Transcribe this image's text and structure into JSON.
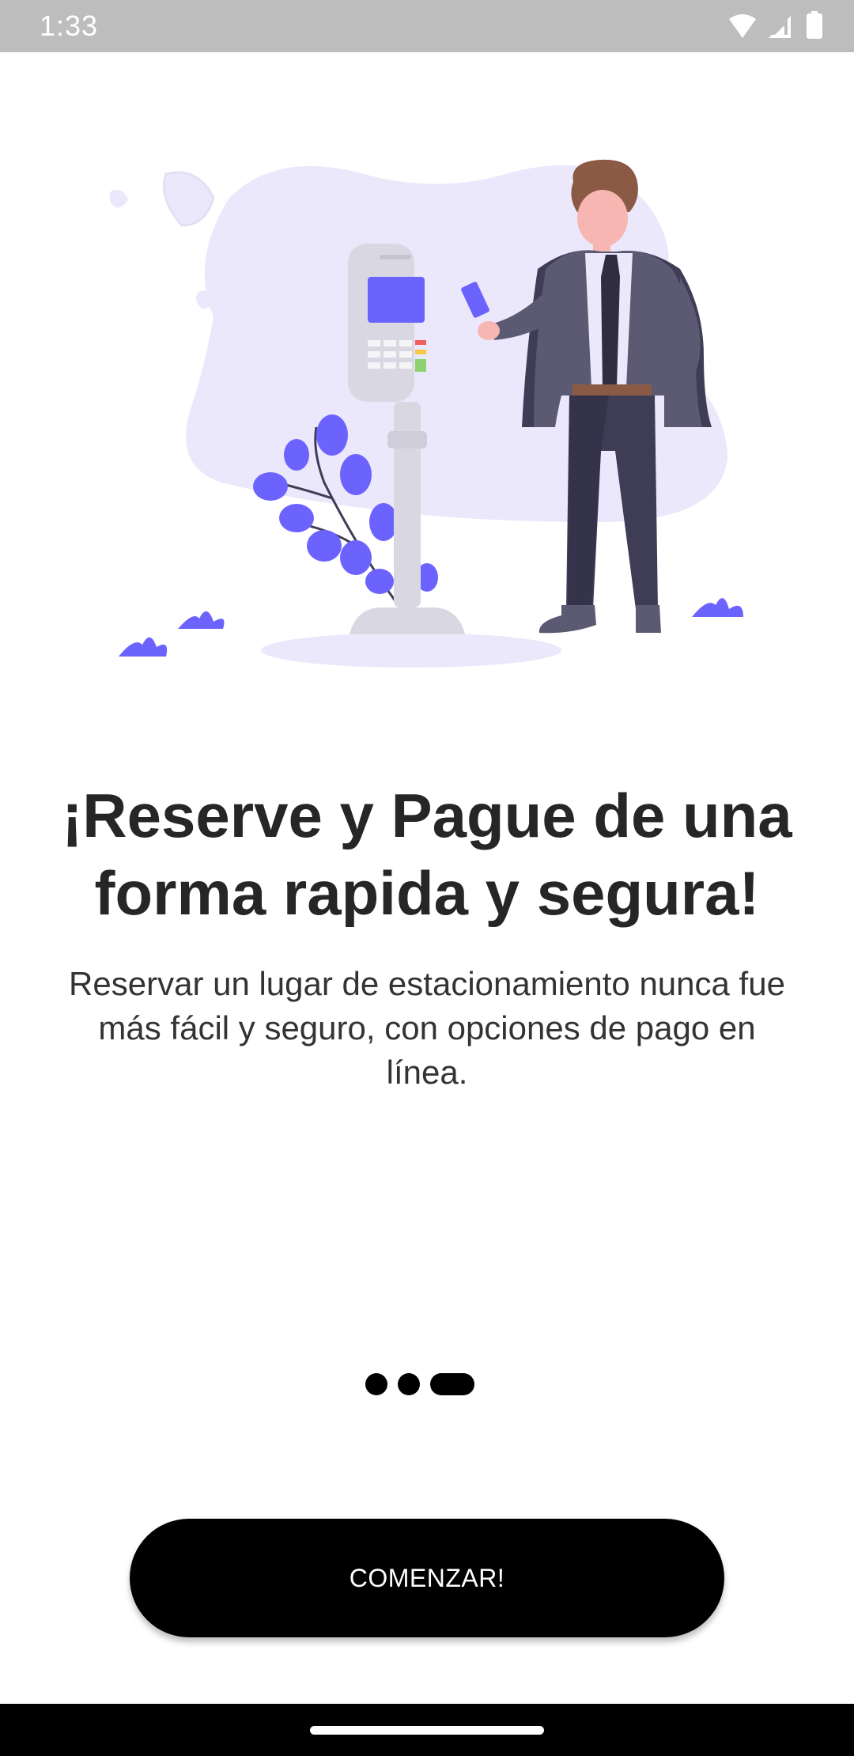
{
  "status_bar": {
    "time": "1:33",
    "icons": [
      "wifi-icon",
      "cellular-signal-icon",
      "battery-icon"
    ]
  },
  "onboarding": {
    "illustration": "person-paying-at-parking-meter",
    "title": "¡Reserve y Pague de una forma rapida y segura!",
    "subtitle": "Reservar un lugar de estacionamiento nunca fue más fácil y seguro, con opciones de pago en línea.",
    "pager": {
      "total": 3,
      "active_index": 2
    },
    "start_button_label": "COMENZAR!"
  },
  "colors": {
    "accent": "#6c63ff",
    "blob": "#ebe8fb",
    "button": "#000000",
    "text_dark": "#262626"
  }
}
